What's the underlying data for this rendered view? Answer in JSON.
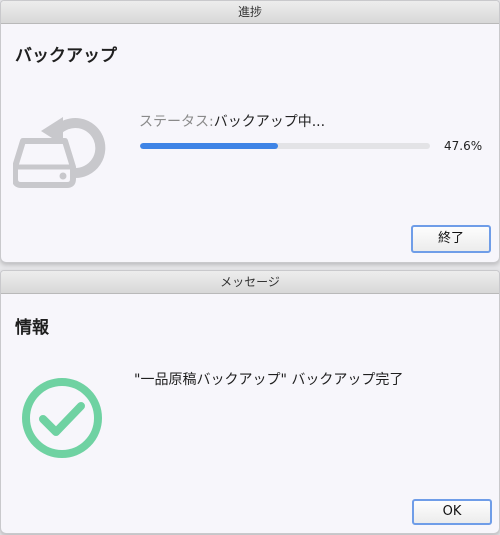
{
  "progress_dialog": {
    "title": "進捗",
    "heading": "バックアップ",
    "status_label": "ステータス:",
    "status_value": "バックアップ中...",
    "progress_fraction": 0.476,
    "progress_text": "47.6%",
    "end_button": "終了",
    "icon": "backup-drive-icon"
  },
  "message_dialog": {
    "title": "メッセージ",
    "heading": "情報",
    "message": "\"一品原稿バックアップ\" バックアップ完了",
    "ok_button": "OK",
    "icon": "success-check-icon"
  },
  "colors": {
    "progress_fill": "#3e84e6",
    "check": "#6fd2a2",
    "button_border": "#6f9de8"
  }
}
